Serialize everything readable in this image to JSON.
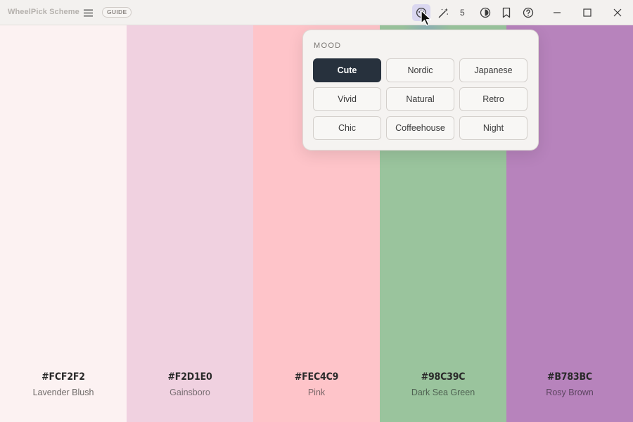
{
  "window": {
    "app_title": "WheelPick Scheme",
    "guide_label": "GUIDE",
    "color_count": "5"
  },
  "toolbar": {
    "icons": [
      "menu-icon",
      "palette-icon",
      "magic-wand-icon",
      "theme-toggle-icon",
      "bookmark-icon",
      "help-icon",
      "minimize-icon",
      "maximize-icon",
      "close-icon"
    ]
  },
  "swatches": [
    {
      "hex": "#FCF2F2",
      "name": "Lavender Blush",
      "color": "#fcf2f2",
      "name_color": "#6e6a68"
    },
    {
      "hex": "#F2D1E0",
      "name": "Gainsboro",
      "color": "#f0d1e0",
      "name_color": "#7a6f74"
    },
    {
      "hex": "#FEC4C9",
      "name": "Pink",
      "color": "#fec4c9",
      "name_color": "#7a6668"
    },
    {
      "hex": "#98C39C",
      "name": "Dark Sea Green",
      "color": "#9ac49d",
      "name_color": "#4f6252"
    },
    {
      "hex": "#B783BC",
      "name": "Rosy Brown",
      "color": "#b783bc",
      "name_color": "#5c4560"
    }
  ],
  "mood": {
    "heading": "MOOD",
    "selected": "Cute",
    "options": [
      "Cute",
      "Nordic",
      "Japanese",
      "Vivid",
      "Natural",
      "Retro",
      "Chic",
      "Coffeehouse",
      "Night"
    ]
  },
  "colors": {
    "selected_bg": "#27313d",
    "active_icon_bg": "#dad7f0"
  }
}
